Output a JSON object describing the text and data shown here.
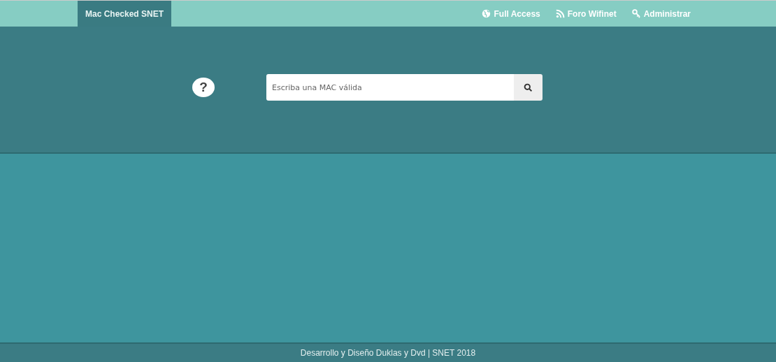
{
  "navbar": {
    "brand": {
      "label": "Mac Checked SNET",
      "selected": true
    },
    "links": [
      {
        "label": "Full Access",
        "kind": "globe"
      },
      {
        "label": "Foro Wifinet",
        "kind": "rss"
      },
      {
        "label": "Administrar",
        "kind": "key"
      }
    ]
  },
  "hero": {
    "help": "?",
    "search": {
      "placeholder": "Escriba una MAC válida"
    }
  },
  "footer": {
    "text": "Desarrollo y Diseño Duklas y Dvd | SNET 2018"
  }
}
